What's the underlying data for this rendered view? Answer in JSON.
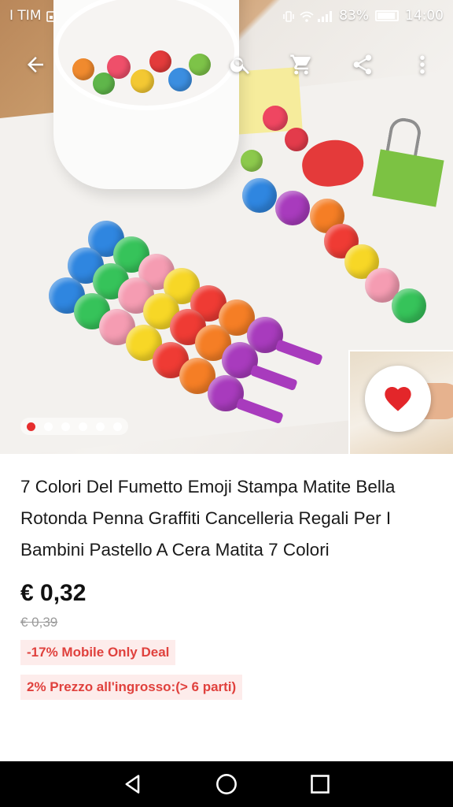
{
  "status_bar": {
    "carrier": "I TIM",
    "battery": "83%",
    "time": "14:00"
  },
  "toolbar": {
    "back_icon": "arrow-left-icon",
    "search_icon": "search-icon",
    "cart_icon": "cart-icon",
    "share_icon": "share-icon",
    "more_icon": "more-vert-icon"
  },
  "gallery": {
    "image_count": 6,
    "active_index": 0
  },
  "wishlist": {
    "icon": "heart-icon",
    "color": "#e3262a"
  },
  "product": {
    "title": "7 Colori Del Fumetto Emoji Stampa Matite Bella Rotonda Penna Graffiti Cancelleria Regali Per I Bambini Pastello A Cera Matita 7 Colori",
    "price": "€ 0,32",
    "old_price": "€ 0,39",
    "discount_tag": "-17% Mobile Only Deal",
    "wholesale_tag": "2% Prezzo all'ingrosso:(> 6 parti)"
  },
  "navigation": {
    "back_icon": "nav-back-icon",
    "home_icon": "nav-home-icon",
    "recents_icon": "nav-recents-icon"
  },
  "colors": {
    "accent": "#e62e2e",
    "tag_text": "#e0413d",
    "tag_bg": "#fdeceb"
  }
}
